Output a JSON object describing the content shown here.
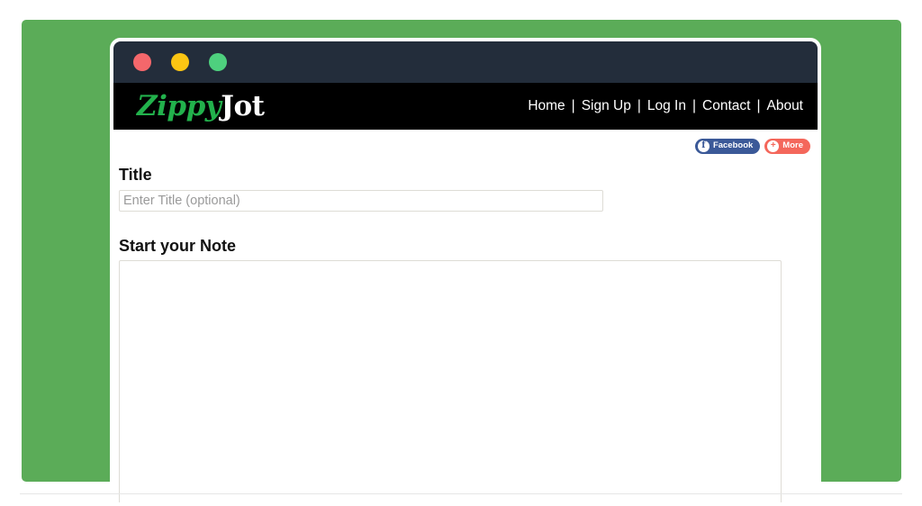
{
  "window": {
    "traffic_lights": [
      {
        "name": "close",
        "color": "#f4676b"
      },
      {
        "name": "minimize",
        "color": "#fbc513"
      },
      {
        "name": "maximize",
        "color": "#4ed07e"
      }
    ],
    "titlebar_color": "#232d3b"
  },
  "theme": {
    "backdrop_green": "#5bac58",
    "navbar_black": "#000000",
    "brand_green": "#22b14c",
    "facebook_blue": "#3b5998",
    "more_red": "#f4675b"
  },
  "brand": {
    "name_first": "Zippy",
    "name_second": "Jot"
  },
  "nav": {
    "separator": "|",
    "items": [
      {
        "label": "Home"
      },
      {
        "label": "Sign Up"
      },
      {
        "label": "Log In"
      },
      {
        "label": "Contact"
      },
      {
        "label": "About"
      }
    ]
  },
  "share": {
    "facebook": {
      "label": "Facebook",
      "glyph": "f",
      "icon": "facebook-icon"
    },
    "more": {
      "label": "More",
      "glyph": "+",
      "icon": "plus-icon"
    }
  },
  "form": {
    "title_label": "Title",
    "title_value": "",
    "title_placeholder": "Enter Title (optional)",
    "note_label": "Start your Note",
    "note_value": "",
    "note_placeholder": ""
  }
}
